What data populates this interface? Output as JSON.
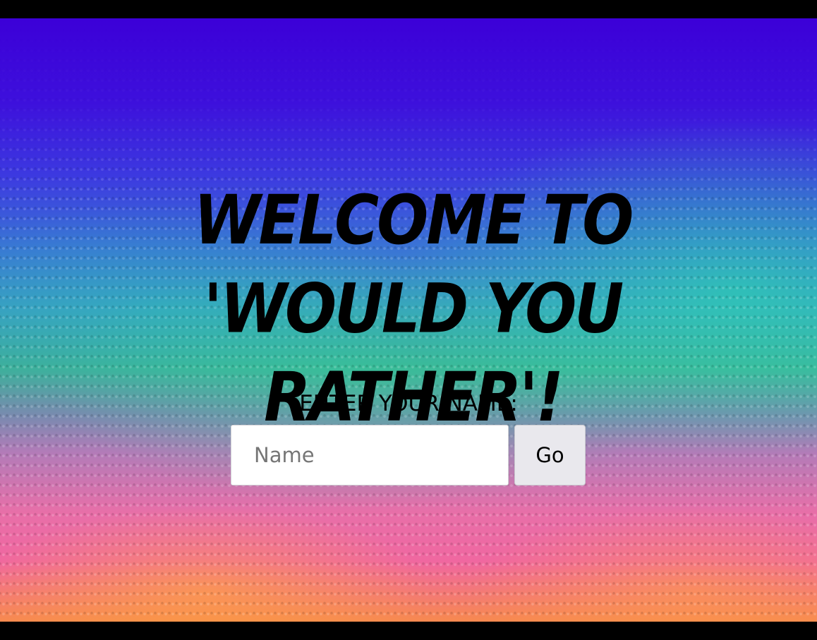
{
  "page": {
    "title": "Welcome to 'Would You Rather'!"
  },
  "form": {
    "prompt": "ENTER YOUR NAME:",
    "name_input": {
      "value": "",
      "placeholder": "Name"
    },
    "go_label": "Go"
  },
  "colors": {
    "frame": "#000000",
    "background_top": "#3c00d8",
    "background_middle": "#3fae9a",
    "background_bottom": "#f067a0",
    "title_text": "#000000",
    "input_background": "#ffffff",
    "button_background": "#e9e8ed"
  }
}
